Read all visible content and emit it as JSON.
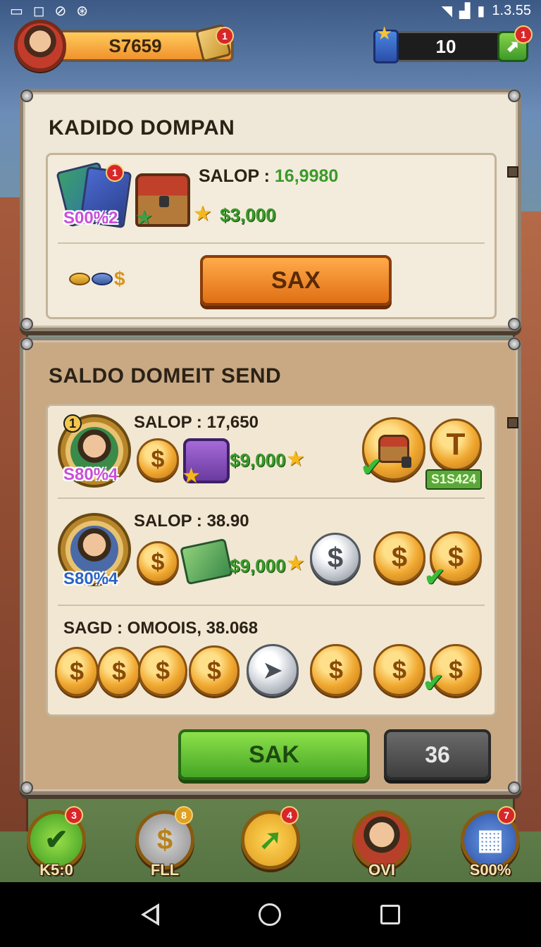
{
  "status_bar": {
    "left_icons": [
      "image-icon",
      "instagram-icon",
      "no-alarm-icon",
      "accessibility-icon"
    ],
    "time": "1.3.55"
  },
  "hud": {
    "money": "S7659",
    "money_badge": "1",
    "gems": "10",
    "gems_badge": "1"
  },
  "panel1": {
    "title": "KADIDO DOMPAN",
    "item_pct": "S00%2",
    "item_badge": "1",
    "salop_label": "SALOP :",
    "salop_value": "16,9980",
    "reward": "$3,000",
    "coins_symbol": "$",
    "button": "SAX"
  },
  "panel2": {
    "title": "SALDO DOMEIT SEND",
    "row1": {
      "level": "1",
      "pct": "S80%4",
      "salop": "SALOP : 17,650",
      "reward": "$9,000",
      "coin_text": "$",
      "big_coin_text": "T",
      "tag": "S1S424"
    },
    "row2": {
      "pct": "S80%4",
      "salop": "SALOP : 38.90",
      "reward": "$9,000",
      "coin_text": "$"
    },
    "row3": {
      "saged": "SAGD : OMOOIS, 38.068",
      "coin_text": "$"
    },
    "button_green": "SAK",
    "button_gray": "36"
  },
  "bottom_nav": [
    {
      "label": "K5:0",
      "badge": "3",
      "icon": "green-arrow-icon"
    },
    {
      "label": "FLL",
      "badge": "8",
      "icon": "coin-stack-icon"
    },
    {
      "label": "",
      "badge": "4",
      "icon": "green-arrow-icon"
    },
    {
      "label": "OVI",
      "badge": "",
      "icon": "avatar-icon"
    },
    {
      "label": "S00%",
      "badge": "7",
      "icon": "grid-icon"
    }
  ],
  "colors": {
    "orange_button": "#f08a24",
    "green_button": "#5cb82e",
    "gray_button": "#555555",
    "panel_bg": "#efe7d7"
  }
}
